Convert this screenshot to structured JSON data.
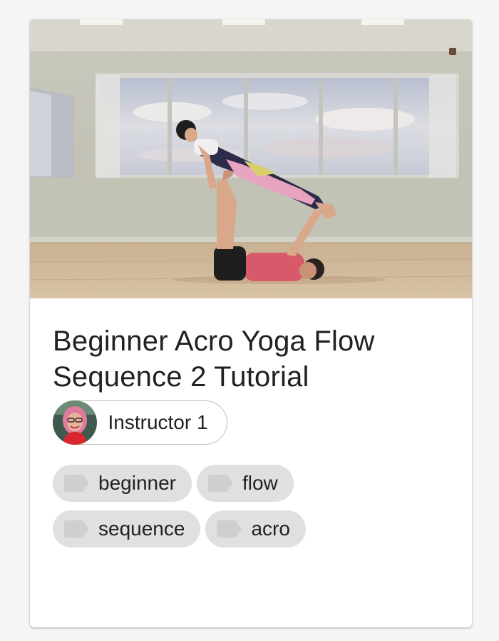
{
  "card": {
    "title": "Beginner Acro Yoga Flow Sequence 2 Tutorial",
    "thumbnail_icon": "acro-yoga-photo",
    "instructor": {
      "name": "Instructor 1",
      "avatar_icon": "instructor-avatar"
    },
    "tags": [
      {
        "label": "beginner",
        "icon": "tag-icon"
      },
      {
        "label": "flow",
        "icon": "tag-icon"
      },
      {
        "label": "sequence",
        "icon": "tag-icon"
      },
      {
        "label": "acro",
        "icon": "tag-icon"
      }
    ]
  },
  "colors": {
    "page_background": "#f5f5f5",
    "card_background": "#ffffff",
    "chip_border": "#bdbdbd",
    "tag_background": "#e0e0e0",
    "tag_icon": "#cfcfcf",
    "text": "#212121"
  }
}
